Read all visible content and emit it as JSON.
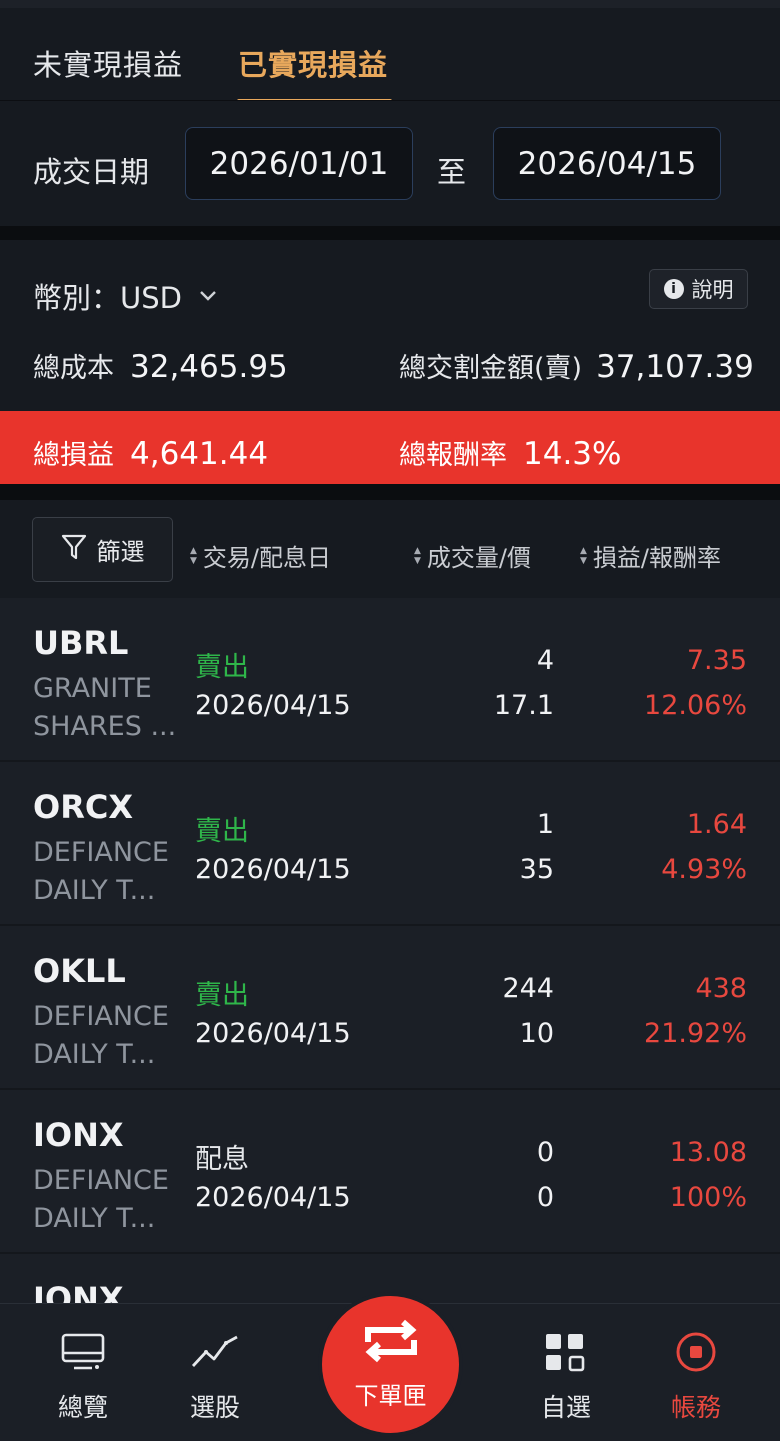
{
  "tabs": {
    "unrealized": "未實現損益",
    "realized": "已實現損益"
  },
  "date_filter": {
    "label": "成交日期",
    "start": "2026/01/01",
    "separator": "至",
    "end": "2026/04/15"
  },
  "summary": {
    "currency_label": "幣別：USD",
    "help_label": "說明",
    "total_cost_label": "總成本",
    "total_cost": "32,465.95",
    "total_sell_label": "總交割金額(賣)",
    "total_sell": "37,107.39",
    "total_pl_label": "總損益",
    "total_pl": "4,641.44",
    "return_label": "總報酬率",
    "return_rate": "14.3%"
  },
  "filter": {
    "button_label": "篩選",
    "col_date": "交易/配息日",
    "col_qty": "成交量/價",
    "col_pl": "損益/報酬率"
  },
  "rows": [
    {
      "symbol": "UBRL",
      "name_line1": "GRANITE",
      "name_line2": "SHARES ...",
      "type": "賣出",
      "date": "2026/04/15",
      "qty": "4",
      "price": "17.1",
      "pl": "7.35",
      "return": "12.06%"
    },
    {
      "symbol": "ORCX",
      "name_line1": "DEFIANCE",
      "name_line2": "DAILY T...",
      "type": "賣出",
      "date": "2026/04/15",
      "qty": "1",
      "price": "35",
      "pl": "1.64",
      "return": "4.93%"
    },
    {
      "symbol": "OKLL",
      "name_line1": "DEFIANCE",
      "name_line2": "DAILY T...",
      "type": "賣出",
      "date": "2026/04/15",
      "qty": "244",
      "price": "10",
      "pl": "438",
      "return": "21.92%"
    },
    {
      "symbol": "IONX",
      "name_line1": "DEFIANCE",
      "name_line2": "DAILY T...",
      "type": "配息",
      "date": "2026/04/15",
      "qty": "0",
      "price": "0",
      "pl": "13.08",
      "return": "100%"
    },
    {
      "symbol": "IONX"
    }
  ],
  "nav": {
    "overview": "總覽",
    "stock_pick": "選股",
    "order_box": "下單匣",
    "watchlist": "自選",
    "account": "帳務"
  },
  "colors": {
    "accent_gold": "#e8a85c",
    "red": "#e8342c",
    "green": "#2fb64a"
  }
}
